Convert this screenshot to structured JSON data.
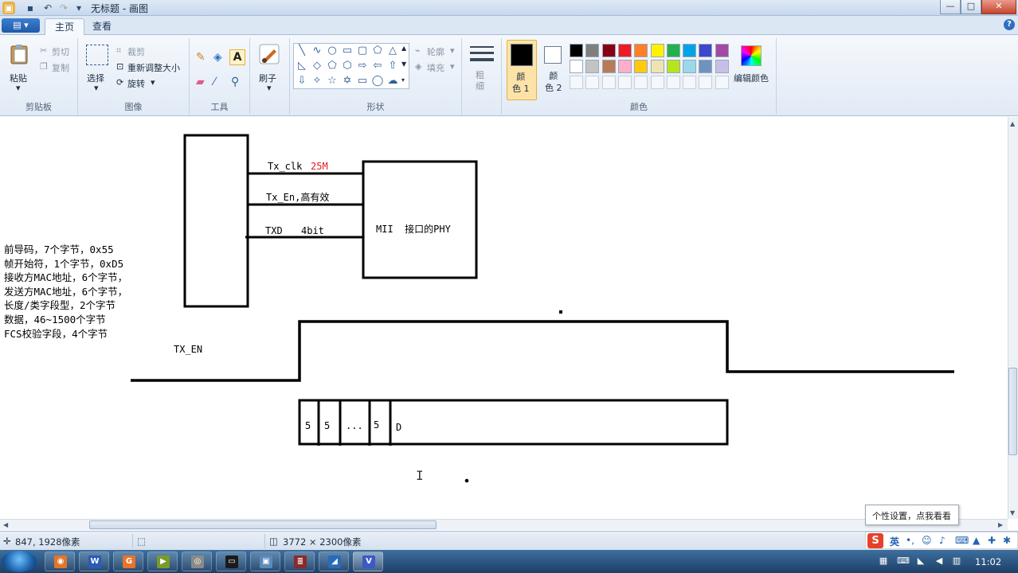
{
  "window": {
    "title": "无标题 - 画图",
    "controls": {
      "minimize": "—",
      "maximize": "□",
      "close": "✕"
    }
  },
  "tabs": {
    "app_menu": "▤ ▾",
    "home": "主页",
    "view": "查看"
  },
  "ribbon": {
    "clipboard": {
      "label": "剪贴板",
      "paste": "粘贴",
      "cut": "剪切",
      "copy": "复制"
    },
    "image": {
      "label": "图像",
      "select": "选择",
      "crop": "裁剪",
      "resize": "重新调整大小",
      "rotate": "旋转"
    },
    "tools": {
      "label": "工具"
    },
    "brush": {
      "label": "刷子"
    },
    "shapes": {
      "label": "形状",
      "outline": "轮廓",
      "fill": "填充"
    },
    "size": {
      "label": "粗细"
    },
    "colors": {
      "label": "颜色",
      "color1": "颜\n色 1",
      "color2": "颜\n色 2",
      "edit": "编辑颜色",
      "color1_value": "#000000",
      "color2_value": "#ffffff",
      "palette_row1": [
        "#000000",
        "#7f7f7f",
        "#880015",
        "#ed1c24",
        "#ff7f27",
        "#fff200",
        "#22b14c",
        "#00a2e8",
        "#3f48cc",
        "#a349a4"
      ],
      "palette_row2": [
        "#ffffff",
        "#c3c3c3",
        "#b97a57",
        "#ffaec9",
        "#ffc90e",
        "#efe4b0",
        "#b5e61d",
        "#99d9ea",
        "#7092be",
        "#c8bfe7"
      ]
    }
  },
  "canvas": {
    "labels": {
      "tx_clk": "Tx_clk",
      "tx_clk_freq": "25M",
      "tx_en_line": "Tx_En,高有效",
      "txd": "TXD",
      "txd_width": "4bit",
      "phy": "MII  接口的PHY",
      "tx_en_signal": "TX_EN",
      "cell_1": "5",
      "cell_2": "5",
      "cell_3": "...",
      "cell_4": "5",
      "cell_5": "D"
    },
    "frame_notes": [
      "前导码，7个字节，0x55",
      "帧开始符，1个字节，0xD5",
      "接收方MAC地址，6个字节，",
      "发送方MAC地址，6个字节，",
      "长度/类字段型，2个字节",
      "数据，46~1500个字节",
      "FCS校验字段，4个字节"
    ]
  },
  "status": {
    "cursor_pos": "847, 1928像素",
    "canvas_size": "3772 × 2300像素"
  },
  "tooltip": "个性设置，点我看看",
  "ime": {
    "logo": "S",
    "lang": "英"
  },
  "taskbar": {
    "clock": "11:02"
  }
}
